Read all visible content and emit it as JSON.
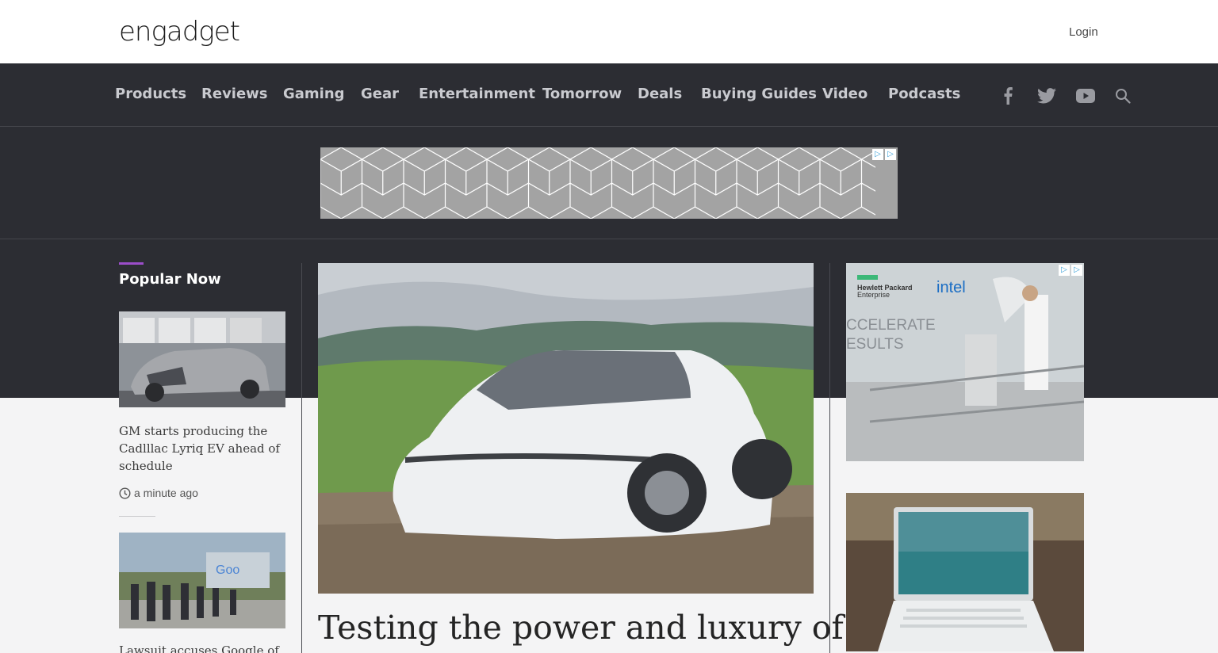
{
  "site": {
    "logo": "engadget",
    "login_label": "Login"
  },
  "nav": {
    "items": [
      {
        "label": "Products"
      },
      {
        "label": "Reviews"
      },
      {
        "label": "Gaming"
      },
      {
        "label": "Gear"
      },
      {
        "label": "Entertainment"
      },
      {
        "label": "Tomorrow"
      },
      {
        "label": "Deals"
      },
      {
        "label": "Buying Guides"
      },
      {
        "label": "Video"
      },
      {
        "label": "Podcasts"
      }
    ],
    "icons": [
      "facebook-icon",
      "twitter-icon",
      "youtube-icon",
      "search-icon"
    ]
  },
  "popular": {
    "heading": "Popular Now",
    "stories": [
      {
        "title": "GM starts producing the Cadlllac Lyriq EV ahead of schedule",
        "time": "a minute ago"
      },
      {
        "title": "Lawsuit accuses Google of",
        "time": ""
      }
    ]
  },
  "hero": {
    "title": "Testing the power and luxury of"
  },
  "side_ad": {
    "brand_1": "Hewlett Packard",
    "brand_1b": "Enterprise",
    "brand_2": "intel",
    "headline_1": "CCELERATE",
    "headline_2": "ESULTS"
  },
  "colors": {
    "accent": "#9b4dca",
    "nav_background": "#2c2d33",
    "page_background": "#f4f4f5"
  }
}
